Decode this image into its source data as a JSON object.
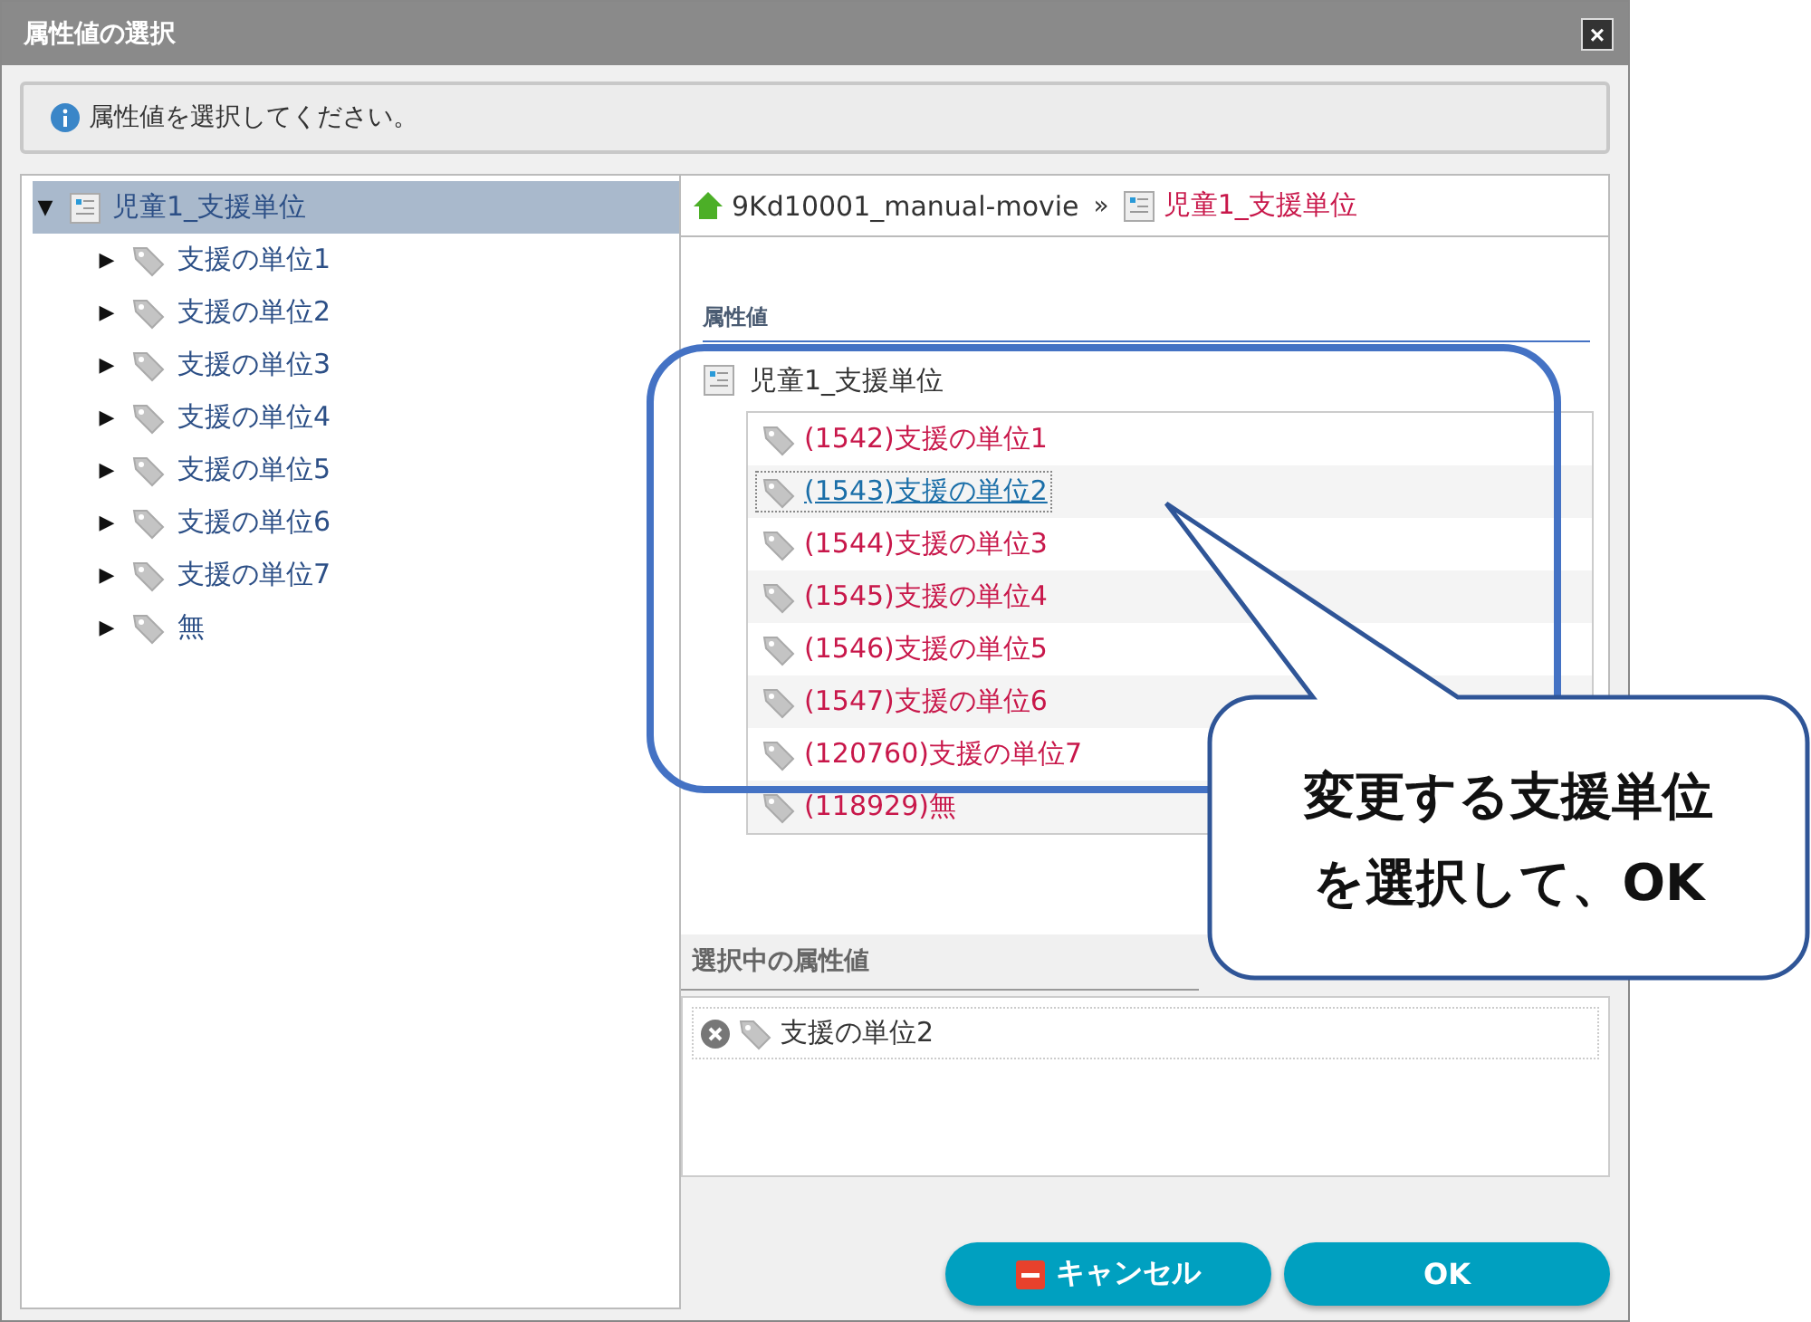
{
  "window": {
    "title": "属性値の選択",
    "close": "×"
  },
  "info": {
    "message": "属性値を選択してください。"
  },
  "tree": {
    "label": "児童1_支援単位",
    "expanded": true,
    "selected": true,
    "expander_open": "▼",
    "expander_closed": "▶",
    "children": [
      {
        "label": "支援の単位1",
        "expanded": false
      },
      {
        "label": "支援の単位2",
        "expanded": false
      },
      {
        "label": "支援の単位3",
        "expanded": false
      },
      {
        "label": "支援の単位4",
        "expanded": false
      },
      {
        "label": "支援の単位5",
        "expanded": false
      },
      {
        "label": "支援の単位6",
        "expanded": false
      },
      {
        "label": "支援の単位7",
        "expanded": false
      },
      {
        "label": "無",
        "expanded": false
      }
    ]
  },
  "breadcrumb": {
    "items": [
      {
        "label": "9Kd10001_manual-movie",
        "kind": "home"
      },
      {
        "label": "児童1_支援単位",
        "kind": "current"
      }
    ],
    "separator": "»"
  },
  "values_section": {
    "heading": "属性値",
    "group": "児童1_支援単位",
    "values": [
      {
        "label": "(1542)支援の単位1",
        "selected": false
      },
      {
        "label": "(1543)支援の単位2",
        "selected": true
      },
      {
        "label": "(1544)支援の単位3",
        "selected": false
      },
      {
        "label": "(1545)支援の単位4",
        "selected": false
      },
      {
        "label": "(1546)支援の単位5",
        "selected": false
      },
      {
        "label": "(1547)支援の単位6",
        "selected": false
      },
      {
        "label": "(120760)支援の単位7",
        "selected": false
      },
      {
        "label": "(118929)無",
        "selected": false
      }
    ]
  },
  "selected_section": {
    "heading": "選択中の属性値",
    "items": [
      {
        "label": "支援の単位2"
      }
    ]
  },
  "buttons": [
    {
      "label": "キャンセル",
      "kind": "cancel"
    },
    {
      "label": "OK",
      "kind": "ok"
    }
  ],
  "annotation": {
    "lines": [
      "変更する支援単位",
      "を選択して、OK"
    ]
  }
}
